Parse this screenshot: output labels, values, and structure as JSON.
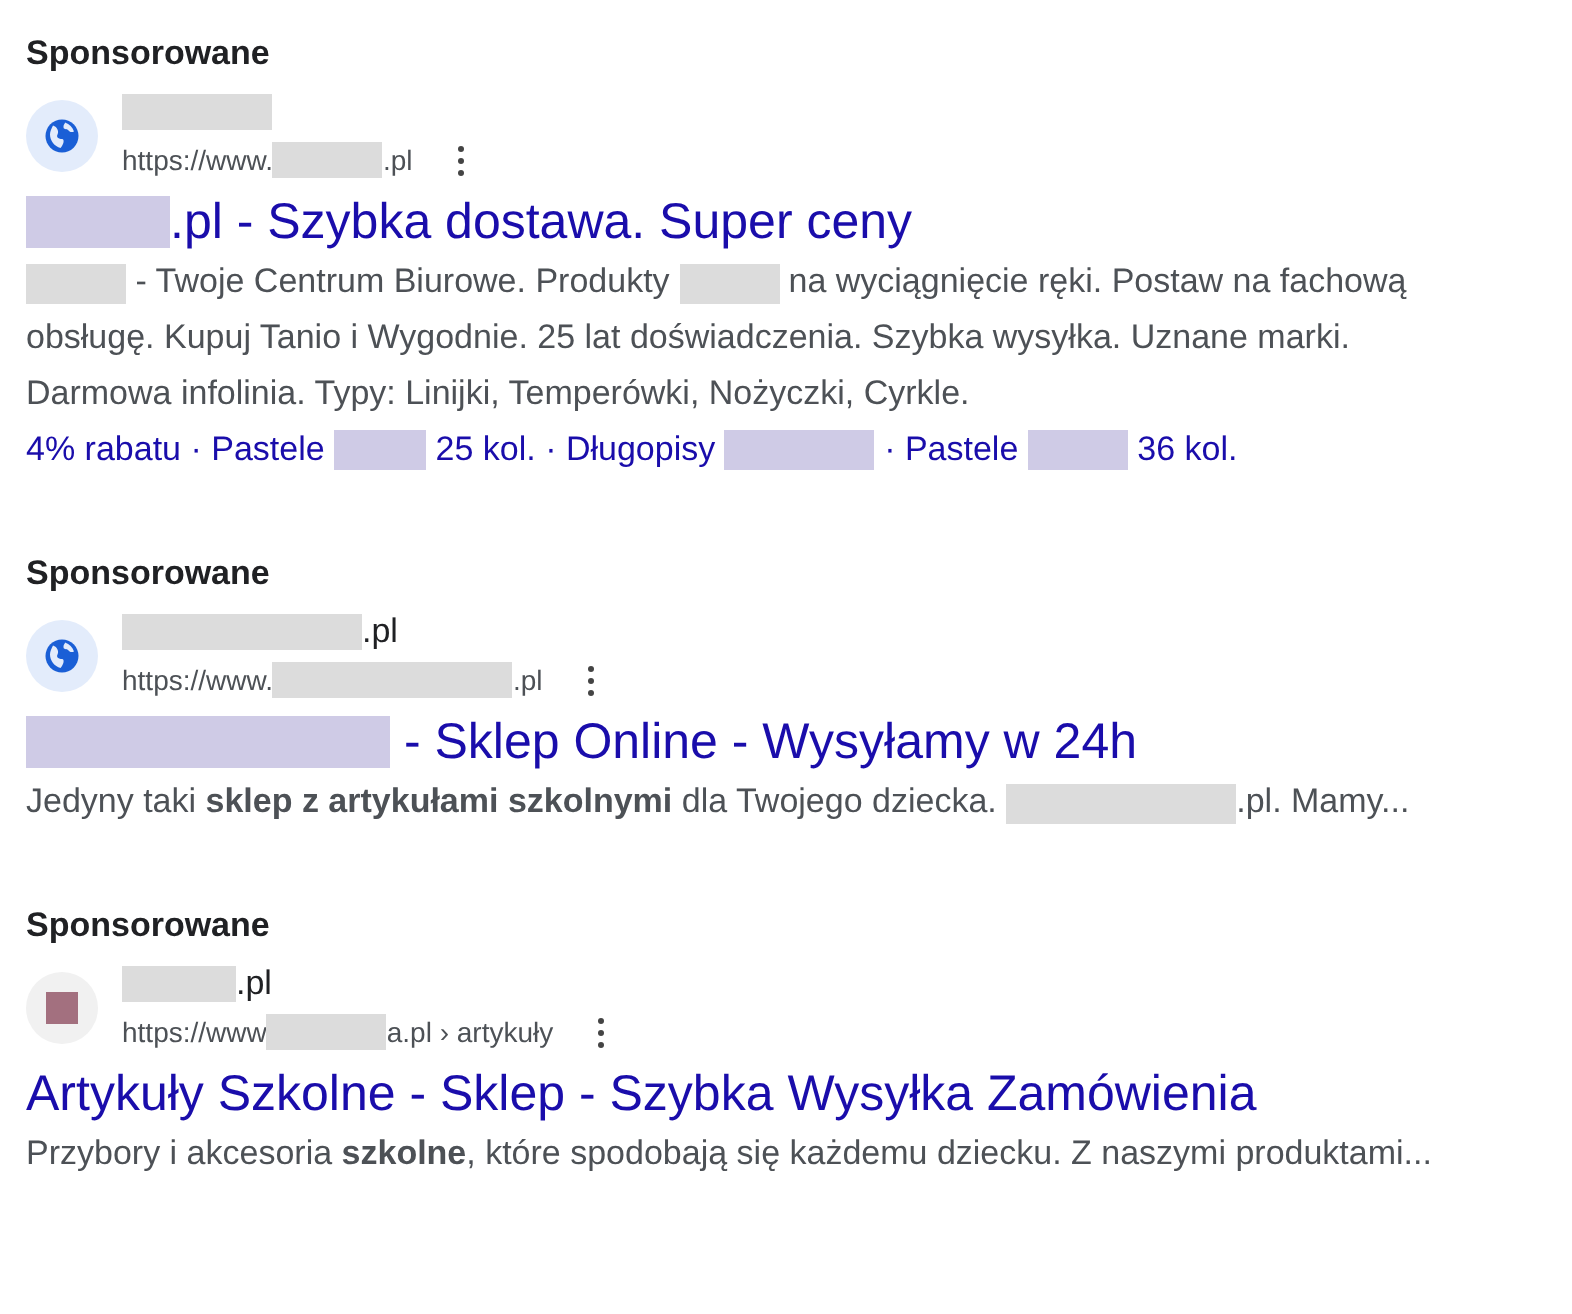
{
  "ads": [
    {
      "label": "Sponsorowane",
      "favicon": {
        "kind": "globe"
      },
      "site_name": [
        {
          "kind": "redacted"
        }
      ],
      "url": [
        {
          "kind": "text",
          "text": "https://www."
        },
        {
          "kind": "redacted"
        },
        {
          "kind": "text",
          "text": ".pl"
        }
      ],
      "title": [
        {
          "kind": "redacted"
        },
        {
          "kind": "text",
          "text": ".pl - Szybka dostawa. Super ceny"
        }
      ],
      "description": [
        {
          "kind": "redacted"
        },
        {
          "kind": "text",
          "text": " - Twoje Centrum Biurowe. Produkty "
        },
        {
          "kind": "redacted"
        },
        {
          "kind": "text",
          "text": " na wyciągnięcie ręki. Postaw na fachową obsługę. Kupuj Tanio i Wygodnie. 25 lat doświadczenia. Szybka wysyłka. Uznane marki. Darmowa infolinia. Typy: Linijki, Temperówki, Nożyczki, Cyrkle."
        }
      ],
      "sitelinks": [
        {
          "kind": "text",
          "text": "4% rabatu · Pastele "
        },
        {
          "kind": "redacted"
        },
        {
          "kind": "text",
          "text": " 25 kol. · Długopisy "
        },
        {
          "kind": "redacted"
        },
        {
          "kind": "text",
          "text": " · Pastele "
        },
        {
          "kind": "redacted"
        },
        {
          "kind": "text",
          "text": " 36 kol."
        }
      ]
    },
    {
      "label": "Sponsorowane",
      "favicon": {
        "kind": "globe"
      },
      "site_name": [
        {
          "kind": "redacted"
        },
        {
          "kind": "text",
          "text": ".pl"
        }
      ],
      "url": [
        {
          "kind": "text",
          "text": "https://www."
        },
        {
          "kind": "redacted"
        },
        {
          "kind": "text",
          "text": ".pl"
        }
      ],
      "title": [
        {
          "kind": "redacted"
        },
        {
          "kind": "text",
          "text": " - Sklep Online - Wysyłamy w 24h"
        }
      ],
      "description": [
        {
          "kind": "text",
          "text": "Jedyny taki **sklep z artykułami szkolnymi** dla Twojego dziecka. "
        },
        {
          "kind": "redacted"
        },
        {
          "kind": "text",
          "text": ".pl. Mamy..."
        }
      ]
    },
    {
      "label": "Sponsorowane",
      "favicon": {
        "kind": "square"
      },
      "site_name": [
        {
          "kind": "redacted"
        },
        {
          "kind": "text",
          "text": ".pl"
        }
      ],
      "url": [
        {
          "kind": "text",
          "text": "https://www"
        },
        {
          "kind": "redacted"
        },
        {
          "kind": "text",
          "text": "a.pl › artykuły"
        }
      ],
      "title": [
        {
          "kind": "text",
          "text": "Artykuły Szkolne - Sklep - Szybka Wysyłka Zamówienia"
        }
      ],
      "description": [
        {
          "kind": "text",
          "text": "Przybory i akcesoria **szkolne**, które spodobają się każdemu dziecku. Z naszymi produktami..."
        }
      ]
    }
  ]
}
